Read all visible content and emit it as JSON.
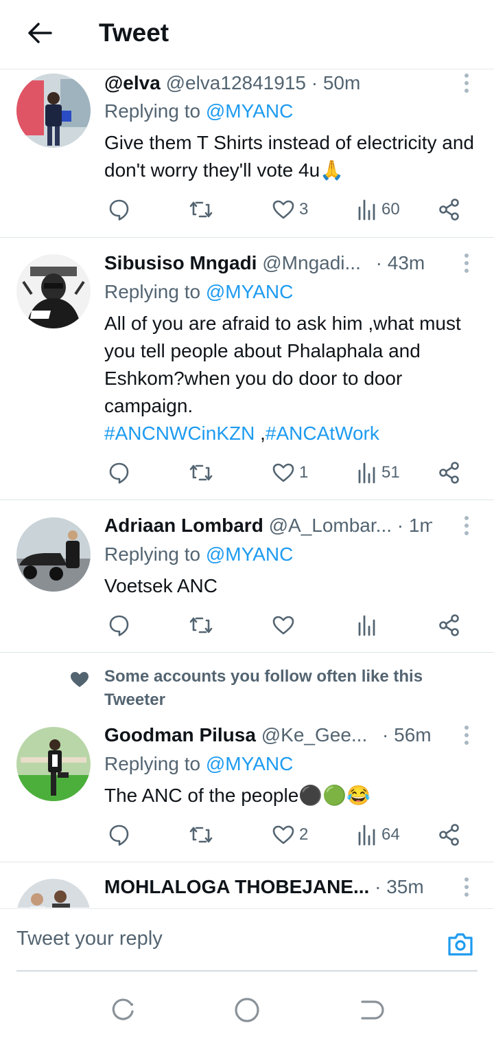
{
  "header": {
    "title": "Tweet"
  },
  "tweets": [
    {
      "name": "@elva",
      "handle": "@elva12841915",
      "time": "· 50m",
      "reply_prefix": "Replying to",
      "reply_to": "@MYANC",
      "text": "Give them T Shirts instead of electricity and don't worry they'll vote 4u🙏",
      "likes": "3",
      "views": "60"
    },
    {
      "name": "Sibusiso Mngadi",
      "handle": "@Mngadi...",
      "time": "· 43m",
      "reply_prefix": "Replying to",
      "reply_to": "@MYANC",
      "text": "All of you are afraid to ask him ,what must you tell people about Phalaphala and Eshkom?when you do door to door campaign.",
      "hashtag1": "#ANCNWCinKZN",
      "hashtag_sep": " ,",
      "hashtag2": "#ANCAtWork",
      "likes": "1",
      "views": "51"
    },
    {
      "name": "Adriaan Lombard",
      "handle": "@A_Lombar...",
      "time": "· 1m",
      "reply_prefix": "Replying to",
      "reply_to": "@MYANC",
      "text": "Voetsek ANC",
      "likes": "",
      "views": ""
    },
    {
      "social_context": "Some accounts you follow often like this Tweeter",
      "name": "Goodman Pilusa",
      "handle": "@Ke_Gee...",
      "time": "· 56m",
      "reply_prefix": "Replying to",
      "reply_to": "@MYANC",
      "text": "The ANC of the people⚫🟢😂",
      "likes": "2",
      "views": "64"
    },
    {
      "name": "MOHLALOGA THOBEJANE...",
      "time": "· 35m"
    }
  ],
  "composer": {
    "placeholder": "Tweet your reply"
  },
  "colors": {
    "link": "#1d9bf0",
    "muted": "#536471",
    "text": "#0f1419",
    "divider": "#e1e5e8"
  },
  "icons": [
    "back-arrow-icon",
    "more-icon",
    "reply-icon",
    "retweet-icon",
    "like-icon",
    "views-icon",
    "share-icon",
    "heart-icon",
    "camera-icon",
    "recents-icon",
    "home-icon",
    "back-icon"
  ]
}
